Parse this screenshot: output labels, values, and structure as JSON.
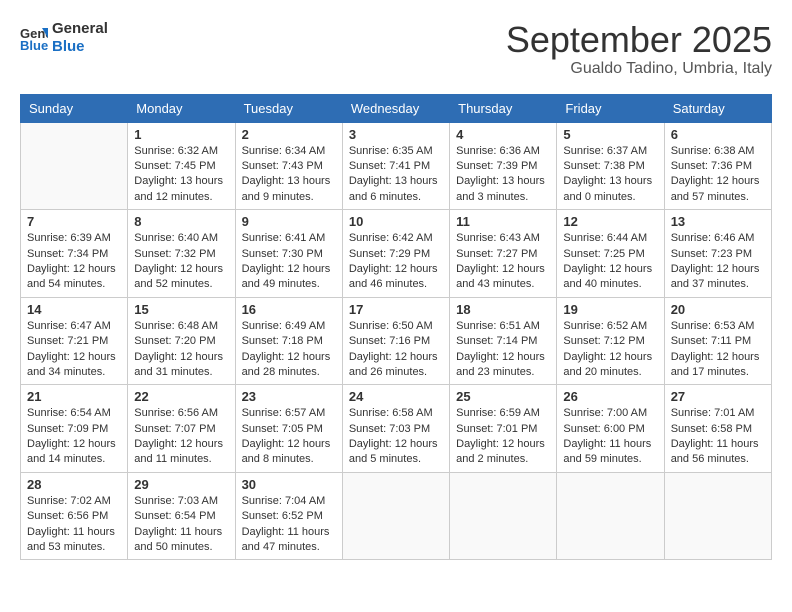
{
  "header": {
    "logo_line1": "General",
    "logo_line2": "Blue",
    "month": "September 2025",
    "location": "Gualdo Tadino, Umbria, Italy"
  },
  "weekdays": [
    "Sunday",
    "Monday",
    "Tuesday",
    "Wednesday",
    "Thursday",
    "Friday",
    "Saturday"
  ],
  "weeks": [
    [
      {
        "day": "",
        "info": ""
      },
      {
        "day": "1",
        "info": "Sunrise: 6:32 AM\nSunset: 7:45 PM\nDaylight: 13 hours\nand 12 minutes."
      },
      {
        "day": "2",
        "info": "Sunrise: 6:34 AM\nSunset: 7:43 PM\nDaylight: 13 hours\nand 9 minutes."
      },
      {
        "day": "3",
        "info": "Sunrise: 6:35 AM\nSunset: 7:41 PM\nDaylight: 13 hours\nand 6 minutes."
      },
      {
        "day": "4",
        "info": "Sunrise: 6:36 AM\nSunset: 7:39 PM\nDaylight: 13 hours\nand 3 minutes."
      },
      {
        "day": "5",
        "info": "Sunrise: 6:37 AM\nSunset: 7:38 PM\nDaylight: 13 hours\nand 0 minutes."
      },
      {
        "day": "6",
        "info": "Sunrise: 6:38 AM\nSunset: 7:36 PM\nDaylight: 12 hours\nand 57 minutes."
      }
    ],
    [
      {
        "day": "7",
        "info": "Sunrise: 6:39 AM\nSunset: 7:34 PM\nDaylight: 12 hours\nand 54 minutes."
      },
      {
        "day": "8",
        "info": "Sunrise: 6:40 AM\nSunset: 7:32 PM\nDaylight: 12 hours\nand 52 minutes."
      },
      {
        "day": "9",
        "info": "Sunrise: 6:41 AM\nSunset: 7:30 PM\nDaylight: 12 hours\nand 49 minutes."
      },
      {
        "day": "10",
        "info": "Sunrise: 6:42 AM\nSunset: 7:29 PM\nDaylight: 12 hours\nand 46 minutes."
      },
      {
        "day": "11",
        "info": "Sunrise: 6:43 AM\nSunset: 7:27 PM\nDaylight: 12 hours\nand 43 minutes."
      },
      {
        "day": "12",
        "info": "Sunrise: 6:44 AM\nSunset: 7:25 PM\nDaylight: 12 hours\nand 40 minutes."
      },
      {
        "day": "13",
        "info": "Sunrise: 6:46 AM\nSunset: 7:23 PM\nDaylight: 12 hours\nand 37 minutes."
      }
    ],
    [
      {
        "day": "14",
        "info": "Sunrise: 6:47 AM\nSunset: 7:21 PM\nDaylight: 12 hours\nand 34 minutes."
      },
      {
        "day": "15",
        "info": "Sunrise: 6:48 AM\nSunset: 7:20 PM\nDaylight: 12 hours\nand 31 minutes."
      },
      {
        "day": "16",
        "info": "Sunrise: 6:49 AM\nSunset: 7:18 PM\nDaylight: 12 hours\nand 28 minutes."
      },
      {
        "day": "17",
        "info": "Sunrise: 6:50 AM\nSunset: 7:16 PM\nDaylight: 12 hours\nand 26 minutes."
      },
      {
        "day": "18",
        "info": "Sunrise: 6:51 AM\nSunset: 7:14 PM\nDaylight: 12 hours\nand 23 minutes."
      },
      {
        "day": "19",
        "info": "Sunrise: 6:52 AM\nSunset: 7:12 PM\nDaylight: 12 hours\nand 20 minutes."
      },
      {
        "day": "20",
        "info": "Sunrise: 6:53 AM\nSunset: 7:11 PM\nDaylight: 12 hours\nand 17 minutes."
      }
    ],
    [
      {
        "day": "21",
        "info": "Sunrise: 6:54 AM\nSunset: 7:09 PM\nDaylight: 12 hours\nand 14 minutes."
      },
      {
        "day": "22",
        "info": "Sunrise: 6:56 AM\nSunset: 7:07 PM\nDaylight: 12 hours\nand 11 minutes."
      },
      {
        "day": "23",
        "info": "Sunrise: 6:57 AM\nSunset: 7:05 PM\nDaylight: 12 hours\nand 8 minutes."
      },
      {
        "day": "24",
        "info": "Sunrise: 6:58 AM\nSunset: 7:03 PM\nDaylight: 12 hours\nand 5 minutes."
      },
      {
        "day": "25",
        "info": "Sunrise: 6:59 AM\nSunset: 7:01 PM\nDaylight: 12 hours\nand 2 minutes."
      },
      {
        "day": "26",
        "info": "Sunrise: 7:00 AM\nSunset: 6:00 PM\nDaylight: 11 hours\nand 59 minutes."
      },
      {
        "day": "27",
        "info": "Sunrise: 7:01 AM\nSunset: 6:58 PM\nDaylight: 11 hours\nand 56 minutes."
      }
    ],
    [
      {
        "day": "28",
        "info": "Sunrise: 7:02 AM\nSunset: 6:56 PM\nDaylight: 11 hours\nand 53 minutes."
      },
      {
        "day": "29",
        "info": "Sunrise: 7:03 AM\nSunset: 6:54 PM\nDaylight: 11 hours\nand 50 minutes."
      },
      {
        "day": "30",
        "info": "Sunrise: 7:04 AM\nSunset: 6:52 PM\nDaylight: 11 hours\nand 47 minutes."
      },
      {
        "day": "",
        "info": ""
      },
      {
        "day": "",
        "info": ""
      },
      {
        "day": "",
        "info": ""
      },
      {
        "day": "",
        "info": ""
      }
    ]
  ]
}
